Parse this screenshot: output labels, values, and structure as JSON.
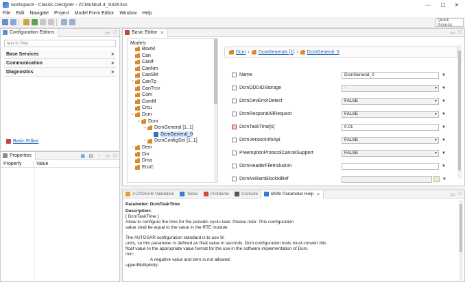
{
  "window": {
    "title": "workspace - Classic.Designer - ZCMuNiu4.4_S32K3xx",
    "min": "—",
    "max": "☐",
    "close": "✕"
  },
  "menu": [
    "File",
    "Edit",
    "Navigate",
    "Project",
    "Model Form Editor",
    "Window",
    "Help"
  ],
  "toolbar": {
    "quick_access": "Quick Access"
  },
  "config_editors": {
    "tab_label": "Configuration Editors",
    "filter_placeholder": "text to filter...",
    "categories": [
      {
        "label": "Base Services",
        "chevron": "»"
      },
      {
        "label": "Communication",
        "chevron": "»"
      },
      {
        "label": "Diagnostics",
        "chevron": "»"
      }
    ],
    "basic_editor_link": "Basic Editor"
  },
  "properties": {
    "tab_label": "Properties",
    "col_property": "Property",
    "col_value": "Value"
  },
  "basic_editor": {
    "tab_label": "Basic Editor",
    "models_label": "Models",
    "tree": [
      {
        "label": "BswM",
        "level": 0,
        "exp": ""
      },
      {
        "label": "Can",
        "level": 0,
        "exp": ""
      },
      {
        "label": "CanIf",
        "level": 0,
        "exp": ""
      },
      {
        "label": "CanNm",
        "level": 0,
        "exp": ""
      },
      {
        "label": "CanSM",
        "level": 0,
        "exp": ""
      },
      {
        "label": "CanTp",
        "level": 0,
        "exp": "›"
      },
      {
        "label": "CanTrcv",
        "level": 0,
        "exp": ""
      },
      {
        "label": "Com",
        "level": 0,
        "exp": ""
      },
      {
        "label": "ComM",
        "level": 0,
        "exp": ""
      },
      {
        "label": "Crcu",
        "level": 0,
        "exp": ""
      },
      {
        "label": "Dcm",
        "level": 0,
        "exp": "⌄"
      },
      {
        "label": "Dcm",
        "level": 1,
        "exp": "⌄"
      },
      {
        "label": "DcmGeneral [1..1]",
        "level": 2,
        "exp": "⌄"
      },
      {
        "label": "DcmGeneral_0",
        "level": 3,
        "exp": "",
        "selected": true
      },
      {
        "label": "DcmConfigSet [1..1]",
        "level": 2,
        "exp": "›"
      },
      {
        "label": "Dem",
        "level": 0,
        "exp": "›"
      },
      {
        "label": "Dio",
        "level": 0,
        "exp": ""
      },
      {
        "label": "Dma",
        "level": 0,
        "exp": ""
      },
      {
        "label": "EcuC",
        "level": 0,
        "exp": ""
      }
    ],
    "breadcrumb": [
      "Dcm",
      "DcmGenerals [1]",
      "DcmGeneral_0"
    ],
    "fields": [
      {
        "label": "Name",
        "value": "DcmGeneral_0",
        "dropdown": false,
        "readonly": false
      },
      {
        "label": "DcmDDDIDStorage",
        "value": "-",
        "dropdown": true,
        "readonly": true
      },
      {
        "label": "DcmDevErrorDetect",
        "value": "FALSE",
        "dropdown": true,
        "readonly": true
      },
      {
        "label": "DcmRespondAllRequest",
        "value": "FALSE",
        "dropdown": true,
        "readonly": true
      },
      {
        "label": "DcmTaskTime[s]",
        "value": "0.01",
        "dropdown": false,
        "readonly": false
      },
      {
        "label": "DcmVersionInfoApi",
        "value": "FALSE",
        "dropdown": true,
        "readonly": true
      },
      {
        "label": "PreemptionProtocolCancelSupport",
        "value": "FALSE",
        "dropdown": true,
        "readonly": true
      },
      {
        "label": "DcmHeaderFileInclusion",
        "value": "",
        "dropdown": false,
        "readonly": false
      },
      {
        "label": "DcmNvRamBlockIdRef",
        "value": "",
        "dropdown": false,
        "readonly": true
      }
    ]
  },
  "bottom": {
    "tabs": [
      "AUTOSAR Validation",
      "Tasks",
      "Problems",
      "Console",
      "BSW Parameter Help"
    ],
    "active_tab": 4,
    "help": {
      "parameter": "Parameter: DcmTaskTime",
      "description_label": "Description:",
      "lines": [
        "[ DcmTaskTime ]",
        "Allow to configure the time for the periodic cyclic task. Please note: This configuration",
        "value shall be equal to the value in the RTE module.",
        "",
        "The AUTOSAR configuration standard is to use SI",
        "units, so this parameter is defined as float value in seconds. Dcm configuration tools must convert this",
        "float value to the appropriate value format for the use in the software implementation of Dcm.",
        "min:",
        "                    A negative value and zero is not allowed.",
        "upperMultiplicity:"
      ]
    }
  }
}
